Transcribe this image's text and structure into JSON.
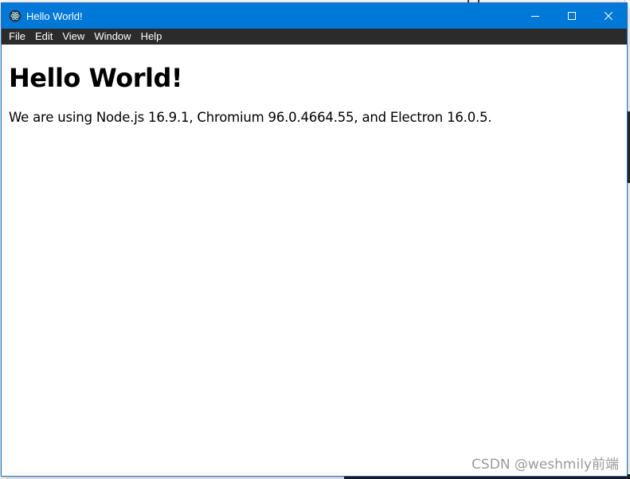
{
  "window": {
    "title": "Hello World!",
    "accent_color": "#0078d7",
    "menubar_color": "#2b2b2b"
  },
  "menu": {
    "items": [
      "File",
      "Edit",
      "View",
      "Window",
      "Help"
    ]
  },
  "content": {
    "heading": "Hello World!",
    "versions_prefix": "We are using Node.js ",
    "node_version": "16.9.1",
    "chromium_prefix": ", Chromium ",
    "chromium_version": "96.0.4664.55",
    "electron_prefix": ", and Electron ",
    "electron_version": "16.0.5",
    "suffix": "."
  },
  "watermark": {
    "text": "CSDN @weshmily前端"
  },
  "icons": {
    "app": "electron-atom-icon",
    "minimize": "minimize-icon",
    "maximize": "maximize-icon",
    "close": "close-icon"
  }
}
